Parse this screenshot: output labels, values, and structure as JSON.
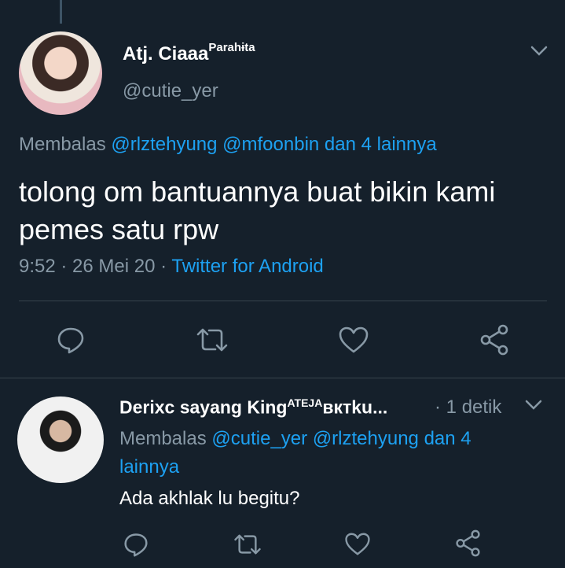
{
  "main_tweet": {
    "display_name": "Atj. Ciaaa",
    "name_suffix": "Parahɨta",
    "handle": "@cutie_yer",
    "reply_prefix": "Membalas",
    "reply_mention_1": "@rlztehyung",
    "reply_mention_2": "@mfoonbin",
    "reply_others": "dan 4 lainnya",
    "text": "tolong om bantuannya buat bikin kami pemes satu rpw",
    "time": "9:52",
    "date": "26 Mei 20",
    "source": "Twitter for Android"
  },
  "reply_tweet": {
    "display_name": "Derixc sayang King",
    "name_sup": "ATEJA",
    "name_tail": "вктku...",
    "time": "1 detik",
    "reply_prefix": "Membalas",
    "reply_mention_1": "@cutie_yer",
    "reply_mention_2": "@rlztehyung",
    "reply_others": "dan 4 lainnya",
    "text": "Ada akhlak lu begitu?"
  },
  "colors": {
    "background": "#15202b",
    "link": "#1da1f2",
    "secondary_text": "#8899a6",
    "divider": "#38444d"
  },
  "icons": [
    "chevron-down-icon",
    "reply-icon",
    "retweet-icon",
    "like-icon",
    "share-icon"
  ]
}
